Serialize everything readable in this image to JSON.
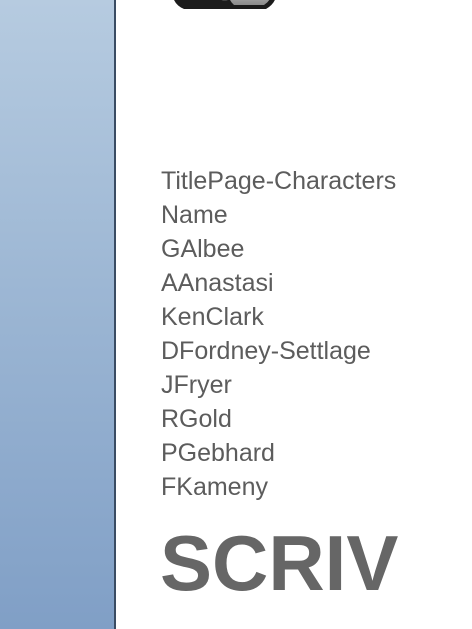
{
  "sidebar": {
    "background_top": "#b6cbe0",
    "background_bottom": "#809fc6"
  },
  "app_icon": {
    "icon": "app-icon"
  },
  "list": {
    "items": [
      "TitlePage-Characters",
      "Name",
      "GAlbee",
      "AAnastasi",
      "KenClark",
      "DFordney-Settlage",
      "JFryer",
      "RGold",
      "PGebhard",
      "FKameny"
    ]
  },
  "wordmark": {
    "text": "SCRIV"
  }
}
